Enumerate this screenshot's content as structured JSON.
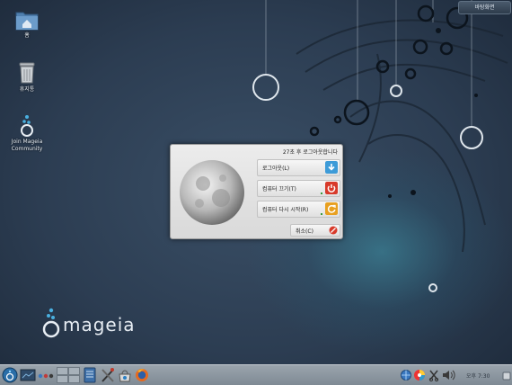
{
  "desktop": {
    "icons": [
      {
        "label": "홈"
      },
      {
        "label": "휴지통"
      },
      {
        "label": "Join Mageia Community"
      }
    ],
    "toggle_button": "바탕화면",
    "logo_text": "mageia"
  },
  "dialog": {
    "message": "27초 후 로그아웃합니다",
    "buttons": [
      {
        "label": "로그아웃(L)",
        "icon": "logout-arrow-icon",
        "color": "#3d9bd8"
      },
      {
        "label": "컴퓨터 끄기(T)",
        "icon": "power-icon",
        "color": "#d83a2a"
      },
      {
        "label": "컴퓨터 다시 시작(R)",
        "icon": "restart-icon",
        "color": "#e8a020"
      }
    ],
    "cancel_label": "취소(C)"
  },
  "taskbar": {
    "clock": "오후 7:30",
    "launchers": [
      "kickoff-menu-icon",
      "desktop-icon",
      "pager-dots-icon",
      "virtual-desktops-icon",
      "file-manager-icon",
      "system-settings-icon",
      "software-install-icon",
      "firefox-icon"
    ],
    "tray": [
      "network-icon",
      "color-wheel-icon",
      "clipboard-icon",
      "volume-icon"
    ]
  }
}
